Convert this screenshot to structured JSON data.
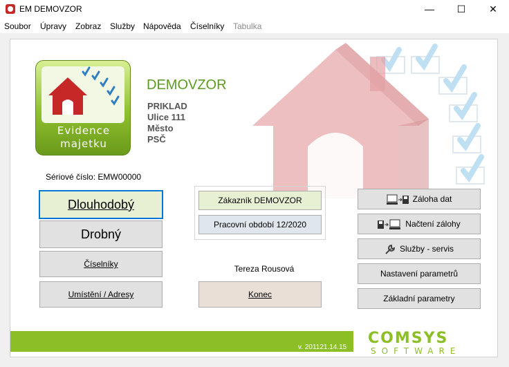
{
  "window": {
    "title": "EM DEMOVZOR"
  },
  "menu": [
    "Soubor",
    "Úpravy",
    "Zobraz",
    "Služby",
    "Nápověda",
    "Číselníky",
    "Tabulka"
  ],
  "logo": {
    "line1": "Evidence",
    "line2": "majetku"
  },
  "company": {
    "name": "DEMOVZOR",
    "line1": "PRIKLAD",
    "line2": "Ulice 111",
    "line3": "Město",
    "line4": "PSČ"
  },
  "serial": "Sériové číslo: EMW00000",
  "left_buttons": {
    "dlouhodoby": "Dlouhodobý",
    "drobny": "Drobný",
    "ciselniky": "Číselníky",
    "umisteni": "Umístění / Adresy"
  },
  "center": {
    "zakaznik": "Zákazník  DEMOVZOR",
    "obdobi": "Pracovní období 12/2020",
    "user": "Tereza Rousová",
    "konec": "Konec"
  },
  "right_buttons": {
    "zaloha": "Záloha dat",
    "nacteni": "Načtení zálohy",
    "sluzby": "Služby - servis",
    "nastaveni": "Nastavení parametrů",
    "zakladni": "Základní parametry"
  },
  "footer": {
    "version": "v. 201121.14.15",
    "brand": "COMSYS",
    "brand_sub": "SOFTWARE"
  }
}
